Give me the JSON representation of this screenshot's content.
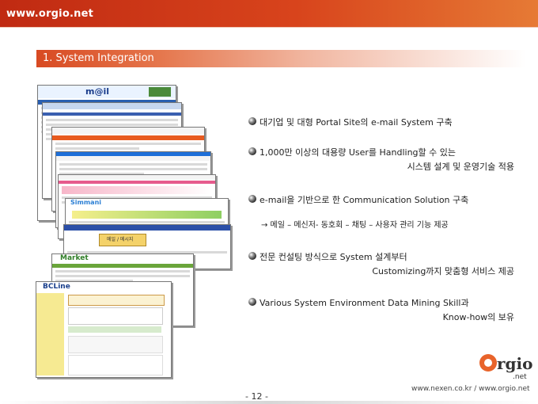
{
  "header": {
    "site_url": "www.orgio.net"
  },
  "section": {
    "title": "1. System Integration"
  },
  "bullets": [
    {
      "line1": "대기업 및 대형 Portal Site의 e-mail System 구축",
      "line2": ""
    },
    {
      "line1": "1,000만 이상의 대용량 User를 Handling할 수 있는",
      "line2": "시스템 설계 및 운영기술 적용"
    },
    {
      "line1": "e-mail을 기반으로 한 Communication Solution 구축",
      "line2": ""
    },
    {
      "line1": "전문 컨설팅 방식으로 System 설계부터",
      "line2": "Customizing까지 맞춤형 서비스 제공"
    },
    {
      "line1": "Various System Environment Data Mining Skill과",
      "line2": "Know-how의 보유"
    }
  ],
  "sub_note": "→ 메일 – 메신저- 동호회 – 채팅 – 사용자 관리 기능 제공",
  "logo": {
    "brand": "rgio",
    "suffix": ".net"
  },
  "footer": {
    "urls": "www.nexen.co.kr / www.orgio.net",
    "page": "- 12 -"
  },
  "screenshots": [
    {
      "label": "m@il"
    },
    {
      "label": ""
    },
    {
      "label": ""
    },
    {
      "label": ""
    },
    {
      "label": ""
    },
    {
      "label": "Simmani"
    },
    {
      "label": "메일 / 메시지"
    },
    {
      "label": "Market"
    },
    {
      "label": "BCLine"
    }
  ],
  "colors": {
    "header_red": "#c02a12",
    "accent_orange": "#e8632a"
  }
}
